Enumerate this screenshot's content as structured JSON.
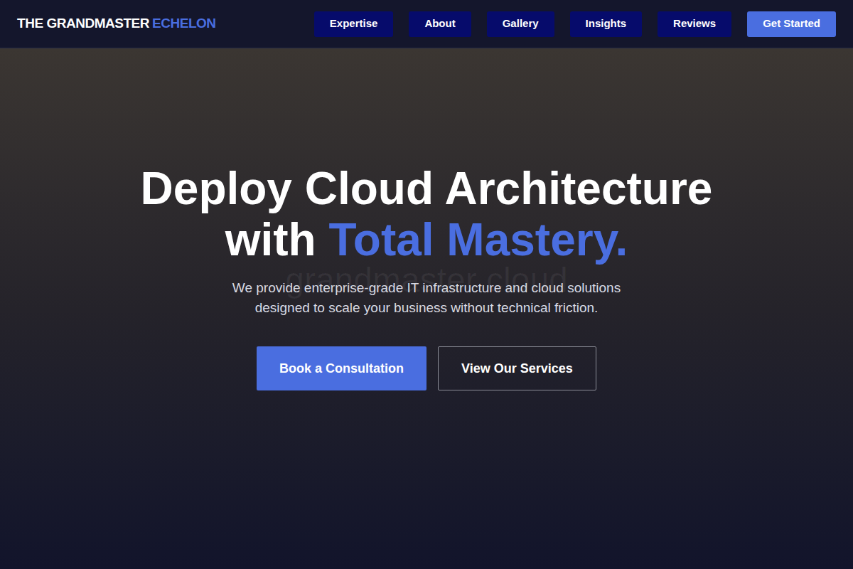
{
  "brand": {
    "name": "THE GRANDMASTER",
    "accent": "ECHELON"
  },
  "nav": {
    "items": [
      {
        "label": "Expertise"
      },
      {
        "label": "About"
      },
      {
        "label": "Gallery"
      },
      {
        "label": "Insights"
      },
      {
        "label": "Reviews"
      }
    ],
    "cta": "Get Started"
  },
  "hero": {
    "title_line1": "Deploy Cloud Architecture",
    "title_line2": "with",
    "title_highlight": "Total Mastery.",
    "watermark": "grandmaster cloud",
    "subtitle_line1": "We provide enterprise-grade IT infrastructure and cloud solutions",
    "subtitle_line2": "designed to scale your business without technical friction.",
    "buttons": [
      {
        "label": "Book a Consultation",
        "kind": "primary"
      },
      {
        "label": "View Our Services",
        "kind": "outline"
      }
    ]
  }
}
